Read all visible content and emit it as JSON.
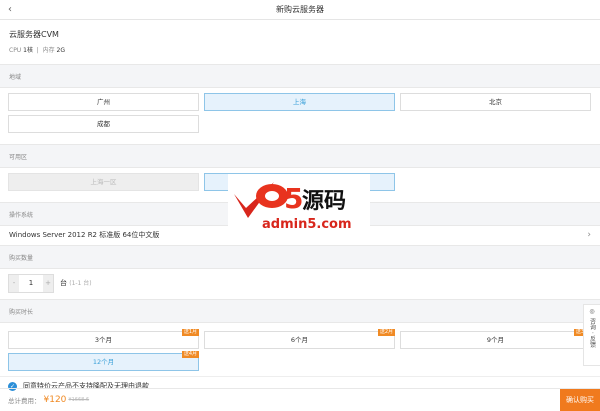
{
  "header": {
    "title": "新购云服务器",
    "back_icon": "chevron-left-icon"
  },
  "product": {
    "name": "云服务器CVM",
    "cpu_label": "CPU",
    "cpu_value": "1核",
    "mem_label": "内存",
    "mem_value": "2G"
  },
  "region": {
    "label": "地域",
    "options": [
      "广州",
      "上海",
      "北京",
      "成都"
    ],
    "selected": "上海"
  },
  "zone": {
    "label": "可用区",
    "options": [
      "上海一区",
      ""
    ],
    "disabled": "上海一区"
  },
  "os": {
    "label": "操作系统",
    "value": "Windows Server 2012 R2 标准版 64位中文版"
  },
  "quantity": {
    "label": "购买数量",
    "minus": "-",
    "value": "1",
    "plus": "+",
    "unit": "台",
    "range": "(1-1 台)"
  },
  "duration": {
    "label": "购买时长",
    "options": [
      {
        "label": "3个月",
        "badge": "送1月"
      },
      {
        "label": "6个月",
        "badge": "送2月"
      },
      {
        "label": "9个月",
        "badge": "送3月"
      },
      {
        "label": "12个月",
        "badge": "送4月"
      }
    ],
    "selected": "12个月"
  },
  "agreement": {
    "text": "同意特价云产品不支持降配及无理由退款",
    "checked": true
  },
  "footer": {
    "total_label": "总计费用：",
    "price": "¥120",
    "original_price": "¥1668.6",
    "buy_label": "确认购买"
  },
  "side": {
    "label": "咨询 · 反馈"
  },
  "watermark": {
    "text": "a5源码 admin5.com"
  },
  "colors": {
    "accent": "#f07a1e",
    "selected": "#3aa0d8",
    "check": "#2c8fd8"
  }
}
